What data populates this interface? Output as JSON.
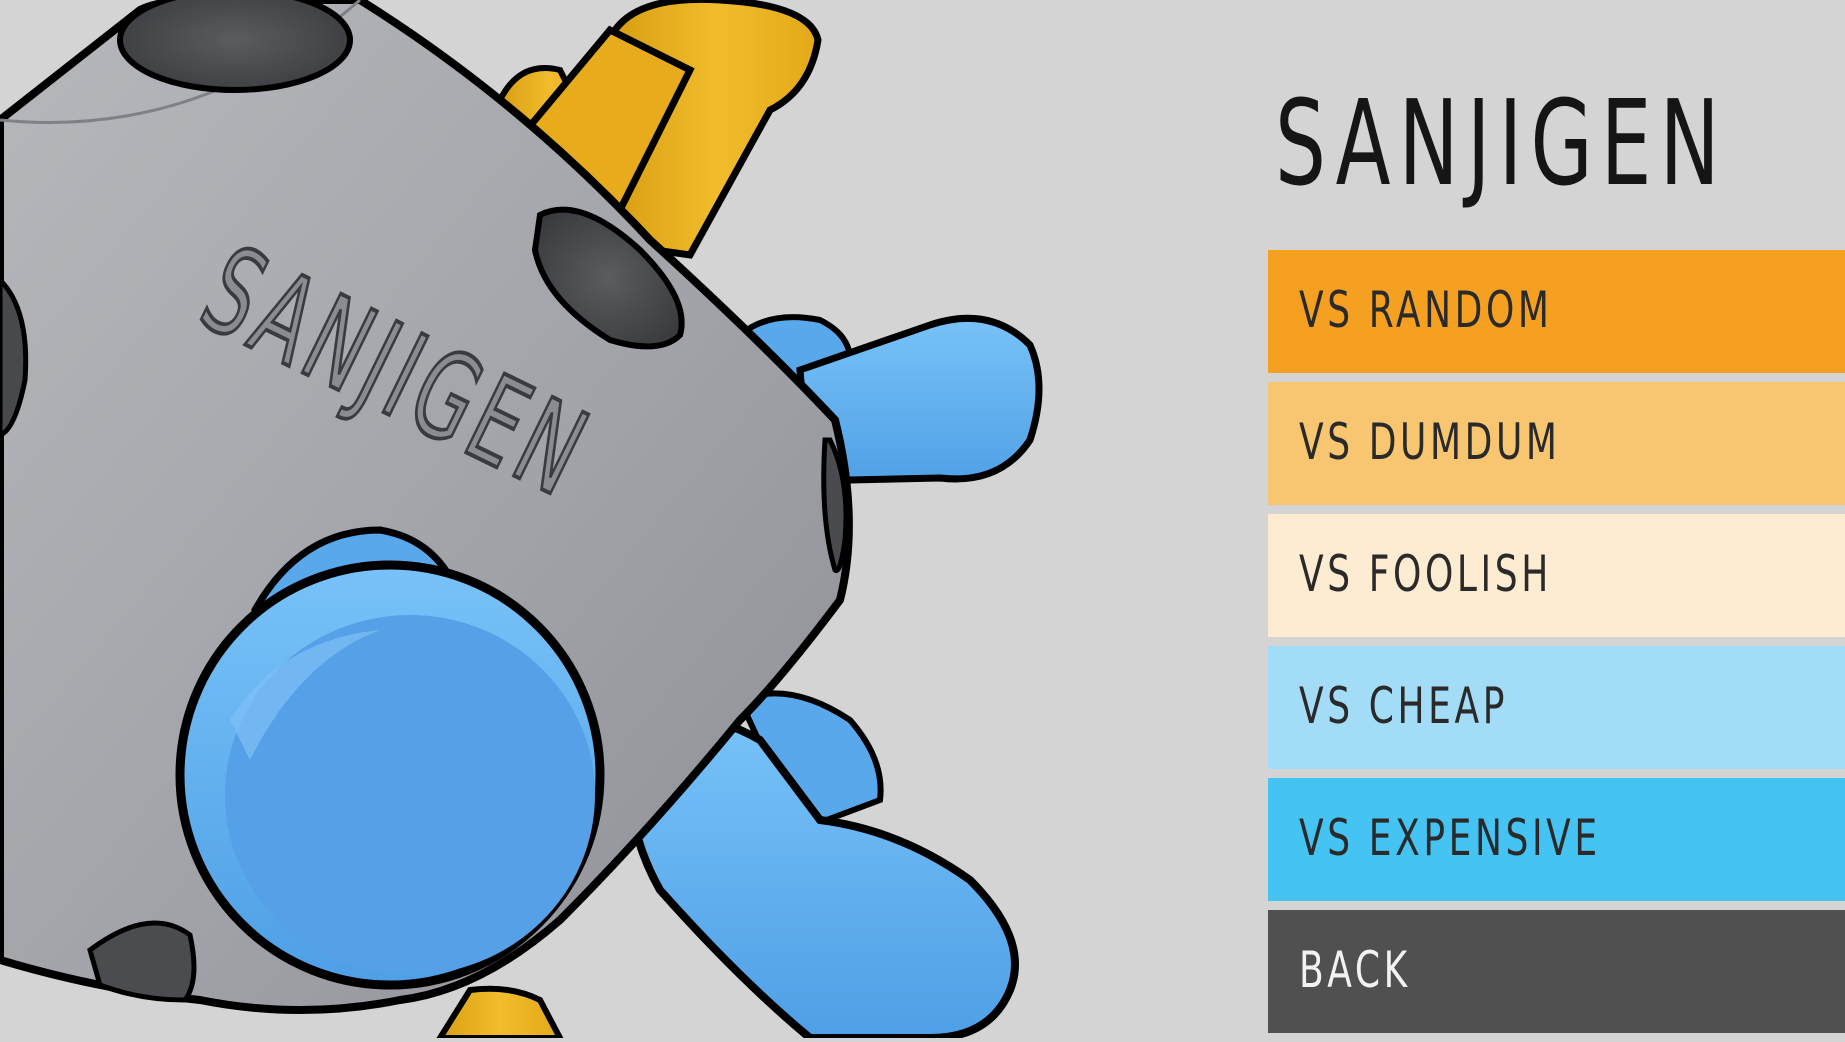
{
  "title": "SANJIGEN",
  "model": {
    "engraving": "SANJIGEN"
  },
  "menu": {
    "items": [
      {
        "label": "VS RANDOM",
        "bg": "#f5a020",
        "fg": "#2a2a2a"
      },
      {
        "label": "VS DUMDUM",
        "bg": "#f8c671",
        "fg": "#2a2a2a"
      },
      {
        "label": "VS FOOLISH",
        "bg": "#fdebd2",
        "fg": "#2a2a2a"
      },
      {
        "label": "VS CHEAP",
        "bg": "#a3dcf7",
        "fg": "#2a2a2a"
      },
      {
        "label": "VS EXPENSIVE",
        "bg": "#45c3f3",
        "fg": "#2a2a2a"
      },
      {
        "label": "BACK",
        "bg": "#505050",
        "fg": "#f2f2f2"
      }
    ]
  },
  "colors": {
    "background": "#d4d4d4",
    "cube_body": "#9d9fa4",
    "yellow_peg": "#ebb220",
    "blue_peg": "#55a6eb"
  }
}
